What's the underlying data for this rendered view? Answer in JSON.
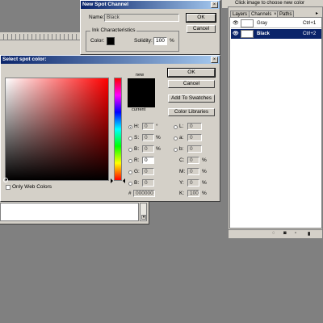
{
  "top_bar": {
    "hint": "Click image to choose new color"
  },
  "new_spot_channel": {
    "title": "New Spot Channel",
    "name_label": "Name:",
    "name_value": "Black",
    "ok": "OK",
    "cancel": "Cancel",
    "ink_group": "Ink Characteristics",
    "color_label": "Color:",
    "solidity_label": "Solidity:",
    "solidity_value": "100",
    "solidity_unit": "%"
  },
  "select_spot_color": {
    "title": "Select spot color:",
    "new_label": "new",
    "current_label": "current",
    "ok": "OK",
    "cancel": "Cancel",
    "add_to_swatches": "Add To Swatches",
    "color_libraries": "Color Libraries",
    "only_web_colors": "Only Web Colors",
    "hsb": [
      {
        "label": "H:",
        "value": "0",
        "unit": "°"
      },
      {
        "label": "S:",
        "value": "0",
        "unit": "%"
      },
      {
        "label": "B:",
        "value": "0",
        "unit": "%"
      }
    ],
    "rgb": [
      {
        "label": "R:",
        "value": "0"
      },
      {
        "label": "G:",
        "value": "0"
      },
      {
        "label": "B:",
        "value": "0"
      }
    ],
    "lab": [
      {
        "label": "L:",
        "value": "0"
      },
      {
        "label": "a:",
        "value": "0"
      },
      {
        "label": "b:",
        "value": "0"
      }
    ],
    "cmyk": [
      {
        "label": "C:",
        "value": "0",
        "unit": "%"
      },
      {
        "label": "M:",
        "value": "0",
        "unit": "%"
      },
      {
        "label": "Y:",
        "value": "0",
        "unit": "%"
      },
      {
        "label": "K:",
        "value": "100",
        "unit": "%"
      }
    ],
    "hex_label": "#",
    "hex_value": "000000"
  },
  "channels_panel": {
    "tabs": [
      "Layers",
      "Channels",
      "Paths"
    ],
    "tab_close": "×",
    "rows": [
      {
        "name": "Gray",
        "shortcut": "Ctrl+1"
      },
      {
        "name": "Black",
        "shortcut": "Ctrl+2"
      }
    ]
  },
  "colors": {
    "accent": "#0a246a",
    "swatch": "#000000",
    "dialog": "#d4d0c8"
  }
}
